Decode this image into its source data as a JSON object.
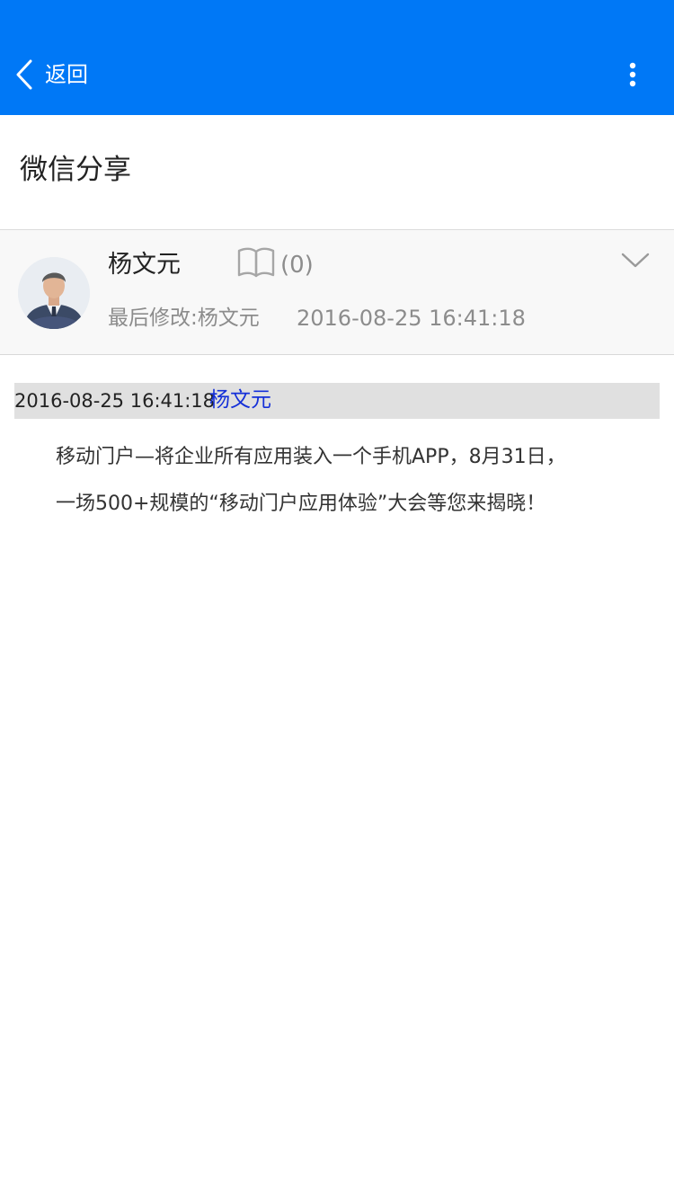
{
  "topbar": {
    "back_label": "返回",
    "background": "#0078f6",
    "icons": [
      "chevron-left-icon",
      "more-vertical-icon"
    ]
  },
  "page": {
    "title": "微信分享"
  },
  "info": {
    "author": "杨文元",
    "read_count": "(0)",
    "modified_label": "最后修改:杨文元",
    "modified_date": "2016-08-25  16:41:18",
    "icons": [
      "book-icon",
      "chevron-down-icon"
    ]
  },
  "entry": {
    "date": "2016-08-25 16:41:18",
    "author": "杨文元",
    "lines": [
      "移动门户—将企业所有应用装入一个手机APP，8月31日，",
      "一场500+规模的“移动门户应用体验”大会等您来揭晓！"
    ],
    "author_color": "#1530d8"
  }
}
